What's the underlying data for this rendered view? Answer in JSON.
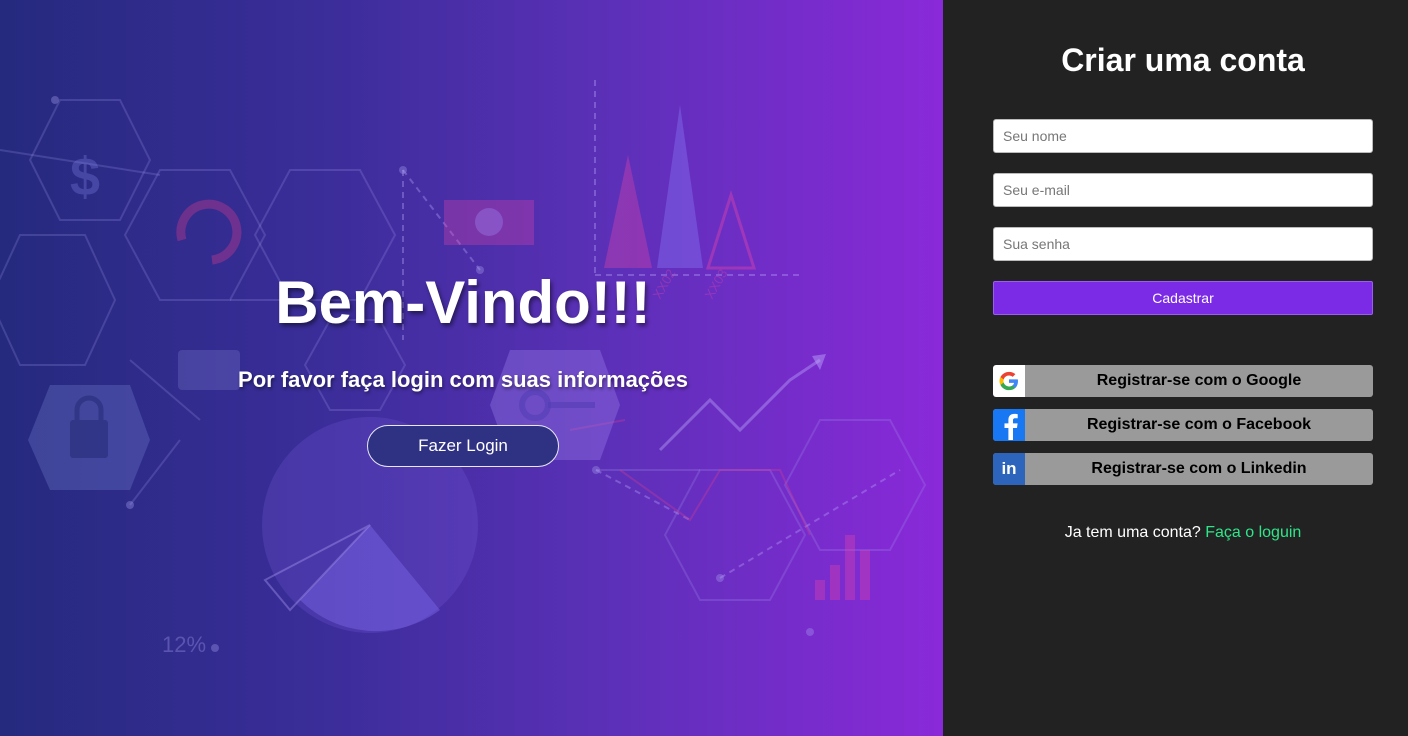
{
  "welcome": {
    "title": "Bem-Vindo!!!",
    "subtitle": "Por favor faça login com suas informações",
    "login_button": "Fazer Login",
    "background_annotations": [
      "$",
      "12%",
      "XX02",
      "XX03"
    ]
  },
  "signup": {
    "title": "Criar uma conta",
    "name_placeholder": "Seu nome",
    "email_placeholder": "Seu e-mail",
    "password_placeholder": "Sua senha",
    "submit_label": "Cadastrar",
    "social": [
      {
        "label": "Registrar-se com o Google",
        "icon": "google-icon"
      },
      {
        "label": "Registrar-se com o Facebook",
        "icon": "facebook-icon"
      },
      {
        "label": "Registrar-se com o Linkedin",
        "icon": "linkedin-icon"
      }
    ],
    "footer_text": "Ja tem uma conta?",
    "footer_link": "Faça o loguin"
  },
  "colors": {
    "gradient_start": "#252a7e",
    "gradient_end": "#8a29d9",
    "panel_bg": "#222222",
    "submit_bg": "#7b2be6",
    "link": "#2ee68a",
    "social_bg": "#9a9a9a"
  }
}
